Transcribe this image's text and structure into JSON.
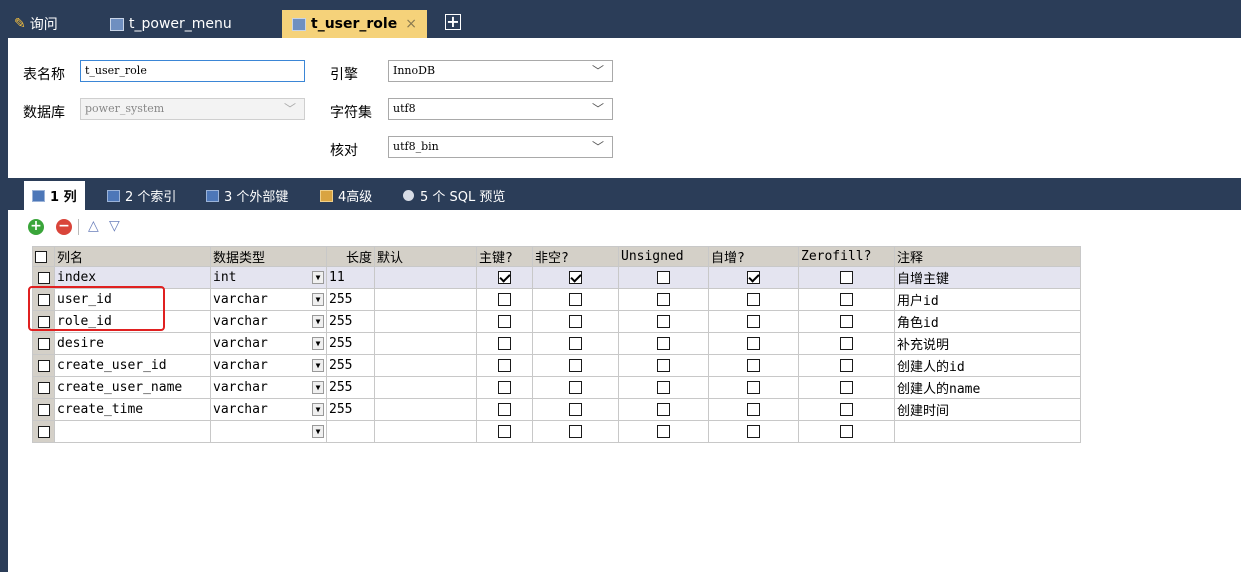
{
  "tabs": [
    {
      "label": "询问",
      "icon": "query-icon",
      "active": false
    },
    {
      "label": "t_power_menu",
      "icon": "table-icon",
      "active": false
    },
    {
      "label": "t_user_role",
      "icon": "table-design-icon",
      "active": true
    }
  ],
  "form": {
    "table_name_label": "表名称",
    "table_name_value": "t_user_role",
    "database_label": "数据库",
    "database_value": "power_system",
    "engine_label": "引擎",
    "engine_value": "InnoDB",
    "charset_label": "字符集",
    "charset_value": "utf8",
    "collation_label": "核对",
    "collation_value": "utf8_bin"
  },
  "subtabs": [
    {
      "label": "1 列",
      "active": true
    },
    {
      "label": "2 个索引",
      "active": false
    },
    {
      "label": "3 个外部键",
      "active": false
    },
    {
      "label": "4高级",
      "active": false
    },
    {
      "label": "5 个 SQL 预览",
      "active": false
    }
  ],
  "grid": {
    "headers": [
      "列名",
      "数据类型",
      "长度",
      "默认",
      "主键?",
      "非空?",
      "Unsigned",
      "自增?",
      "Zerofill?",
      "注释"
    ],
    "rows": [
      {
        "name": "index",
        "type": "int",
        "length": "11",
        "default": "",
        "pk": true,
        "notnull": true,
        "unsigned": false,
        "autoinc": true,
        "zerofill": false,
        "comment": "自增主键"
      },
      {
        "name": "user_id",
        "type": "varchar",
        "length": "255",
        "default": "",
        "pk": false,
        "notnull": false,
        "unsigned": false,
        "autoinc": false,
        "zerofill": false,
        "comment": "用户id"
      },
      {
        "name": "role_id",
        "type": "varchar",
        "length": "255",
        "default": "",
        "pk": false,
        "notnull": false,
        "unsigned": false,
        "autoinc": false,
        "zerofill": false,
        "comment": "角色id"
      },
      {
        "name": "desire",
        "type": "varchar",
        "length": "255",
        "default": "",
        "pk": false,
        "notnull": false,
        "unsigned": false,
        "autoinc": false,
        "zerofill": false,
        "comment": "补充说明"
      },
      {
        "name": "create_user_id",
        "type": "varchar",
        "length": "255",
        "default": "",
        "pk": false,
        "notnull": false,
        "unsigned": false,
        "autoinc": false,
        "zerofill": false,
        "comment": "创建人的id"
      },
      {
        "name": "create_user_name",
        "type": "varchar",
        "length": "255",
        "default": "",
        "pk": false,
        "notnull": false,
        "unsigned": false,
        "autoinc": false,
        "zerofill": false,
        "comment": "创建人的name"
      },
      {
        "name": "create_time",
        "type": "varchar",
        "length": "255",
        "default": "",
        "pk": false,
        "notnull": false,
        "unsigned": false,
        "autoinc": false,
        "zerofill": false,
        "comment": "创建时间"
      },
      {
        "name": "",
        "type": "",
        "length": "",
        "default": "",
        "pk": false,
        "notnull": false,
        "unsigned": false,
        "autoinc": false,
        "zerofill": false,
        "comment": ""
      }
    ]
  },
  "colors": {
    "chrome": "#2b3d58",
    "active_tab": "#f5d27a",
    "highlight": "#e02020"
  }
}
